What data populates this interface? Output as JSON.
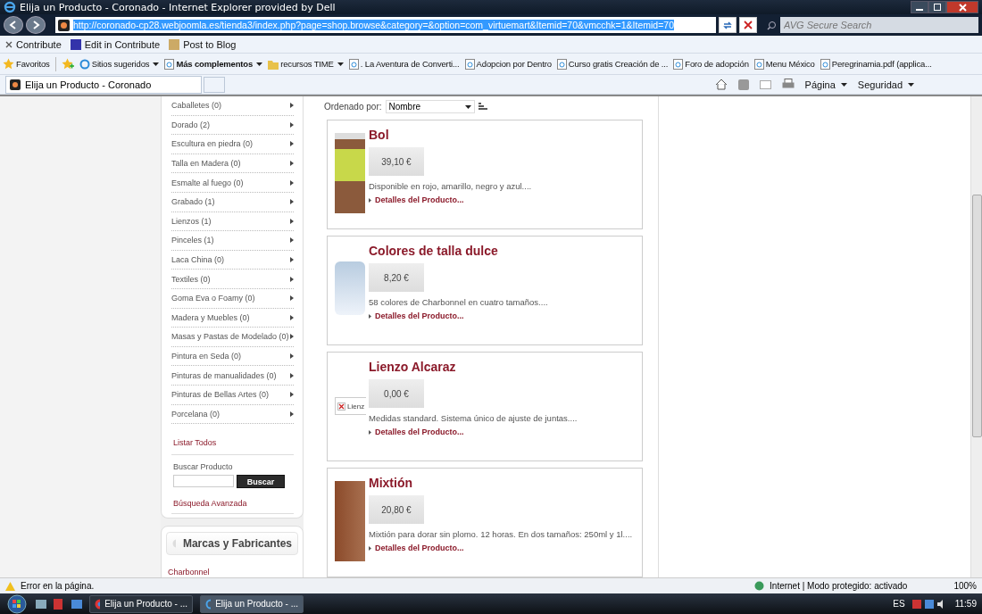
{
  "window": {
    "title": "Elija un Producto - Coronado - Internet Explorer provided by Dell"
  },
  "address_bar": {
    "url": "http://coronado-cp28.webjoomla.es/tienda3/index.php?page=shop.browse&category=&option=com_virtuemart&Itemid=70&vmcchk=1&Itemid=70",
    "search_placeholder": "AVG Secure Search"
  },
  "contribute_bar": [
    "Contribute",
    "Edit in Contribute",
    "Post to Blog"
  ],
  "favorites_bar": {
    "label": "Favoritos",
    "items": [
      {
        "text": "Sitios sugeridos",
        "bold": false,
        "dropdown": true,
        "kind": "ie"
      },
      {
        "text": "Más complementos",
        "bold": true,
        "dropdown": true,
        "kind": "page"
      },
      {
        "text": "recursos TIME",
        "bold": false,
        "dropdown": true,
        "kind": "folder"
      },
      {
        "text": ". La Aventura de Converti...",
        "bold": false,
        "dropdown": false,
        "kind": "page"
      },
      {
        "text": "Adopcion por Dentro",
        "bold": false,
        "dropdown": false,
        "kind": "page"
      },
      {
        "text": "Curso gratis  Creación de ...",
        "bold": false,
        "dropdown": false,
        "kind": "page"
      },
      {
        "text": "Foro de adopción",
        "bold": false,
        "dropdown": false,
        "kind": "page"
      },
      {
        "text": "Menu México",
        "bold": false,
        "dropdown": false,
        "kind": "page"
      },
      {
        "text": "Peregrinamia.pdf (applica...",
        "bold": false,
        "dropdown": false,
        "kind": "page"
      }
    ]
  },
  "tabs": [
    {
      "label": "Elija un Producto - Coronado",
      "selected": true
    }
  ],
  "command_bar": [
    "Página",
    "Seguridad"
  ],
  "sidebar": {
    "categories": [
      "Caballetes (0)",
      "Dorado (2)",
      "Escultura en piedra (0)",
      "Talla en Madera (0)",
      "Esmalte al fuego (0)",
      "Grabado (1)",
      "Lienzos (1)",
      "Pinceles (1)",
      "Laca China (0)",
      "Textiles (0)",
      "Goma Eva o Foamy (0)",
      "Madera y Muebles (0)",
      "Masas y Pastas de Modelado (0)",
      "Pintura en Seda (0)",
      "Pinturas de manualidades (0)",
      "Pinturas de Bellas Artes (0)",
      "Porcelana (0)"
    ],
    "list_all": "Listar Todos",
    "search_label": "Buscar Producto",
    "search_button": "Buscar",
    "advanced_search": "Búsqueda Avanzada",
    "manufacturers_title": "Marcas y Fabricantes",
    "manufacturers": [
      "Charbonnel"
    ]
  },
  "sort": {
    "label": "Ordenado por:",
    "value": "Nombre"
  },
  "products": [
    {
      "name": "Bol",
      "price": "39,10 €",
      "description": "Disponible en rojo, amarillo, negro y azul....",
      "details": "Detalles del Producto...",
      "kind": "jar"
    },
    {
      "name": "Colores de talla dulce",
      "price": "8,20 €",
      "description": "58 colores de Charbonnel en cuatro tamaños....",
      "details": "Detalles del Producto...",
      "kind": "unavailable"
    },
    {
      "name": "Lienzo Alcaraz",
      "price": "0,00 €",
      "description": "Medidas standard. Sistema único de ajuste de juntas....",
      "details": "Detalles del Producto...",
      "kind": "broken",
      "alt": "Lienz"
    },
    {
      "name": "Mixtión",
      "price": "20,80 €",
      "description": "Mixtión para dorar sin plomo. 12 horas. En dos tamaños: 250ml y 1l....",
      "details": "Detalles del Producto...",
      "kind": "can"
    }
  ],
  "status_bar": {
    "message": "Error en la página.",
    "zone": "Internet | Modo protegido: activado",
    "zoom": "100%"
  },
  "taskbar": {
    "windows": [
      {
        "label": "Elija un Producto - ...",
        "kind": "chrome",
        "selected": false
      },
      {
        "label": "Elija un Producto - ...",
        "kind": "ie",
        "selected": true
      }
    ],
    "language": "ES",
    "time": "11:59"
  }
}
